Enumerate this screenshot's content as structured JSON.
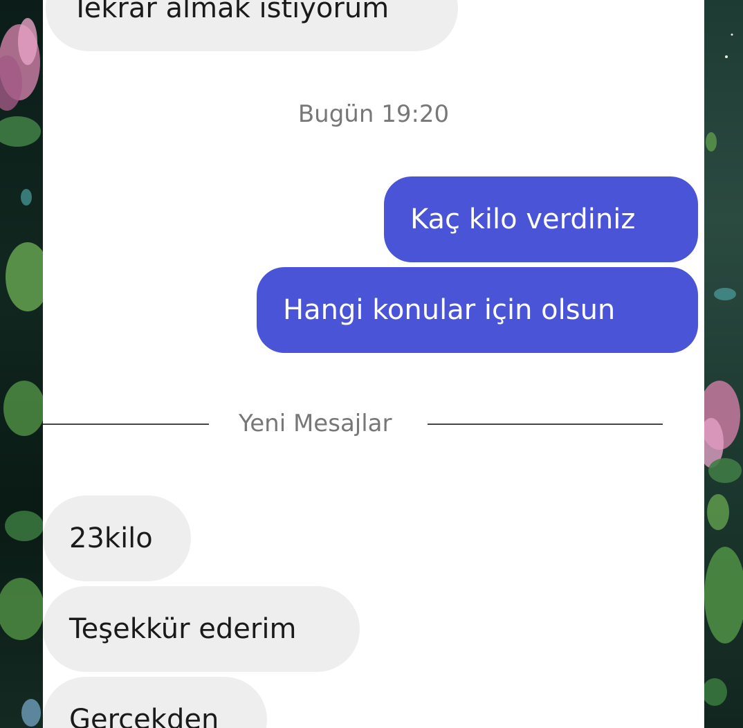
{
  "conversation": {
    "messages_before": [
      {
        "text": "Tekrar almak istiyorum",
        "direction": "incoming"
      }
    ],
    "timestamp": "Bugün 19:20",
    "sent_messages": [
      {
        "text": "Kaç kilo verdiniz"
      },
      {
        "text": "Hangi konular için olsun"
      }
    ],
    "new_messages_divider": "Yeni Mesajlar",
    "received_messages": [
      {
        "text": "23kilo"
      },
      {
        "text": "Teşekkür ederim"
      },
      {
        "text": "Gerçekden"
      }
    ]
  },
  "colors": {
    "outgoing_bubble": "#4a54d6",
    "incoming_bubble": "#eeeeee",
    "background": "#ffffff"
  }
}
